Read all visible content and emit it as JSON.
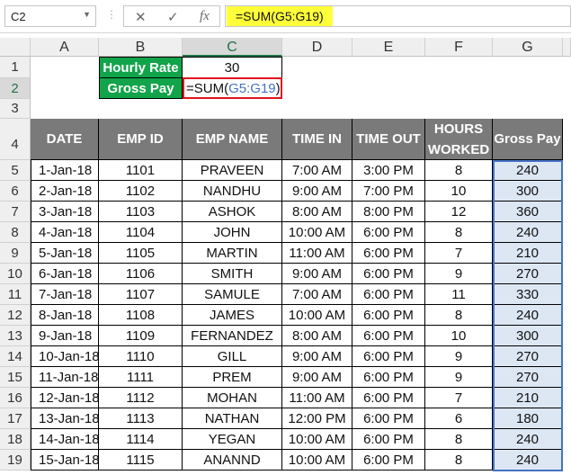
{
  "formula_bar": {
    "name_box": "C2",
    "formula": "=SUM(G5:G19)",
    "cancel_icon": "✕",
    "enter_icon": "✓",
    "fx_label": "fx"
  },
  "columns": [
    "A",
    "B",
    "C",
    "D",
    "E",
    "F",
    "G"
  ],
  "selected_column": "C",
  "row_numbers": [
    "1",
    "2",
    "3",
    "4",
    "5",
    "6",
    "7",
    "8",
    "9",
    "10",
    "11",
    "12",
    "13",
    "14",
    "15",
    "16",
    "17",
    "18",
    "19"
  ],
  "summary": {
    "hourly_rate_label": "Hourly Rate",
    "hourly_rate_value": "30",
    "gross_pay_label": "Gross Pay",
    "gross_pay_edit_prefix": "=SUM(",
    "gross_pay_edit_ref": "G5:G19",
    "gross_pay_edit_suffix": ")"
  },
  "table": {
    "headers": [
      "DATE",
      "EMP ID",
      "EMP NAME",
      "TIME IN",
      "TIME OUT",
      "HOURS WORKED",
      "Gross Pay"
    ],
    "rows": [
      [
        "1-Jan-18",
        "1101",
        "PRAVEEN",
        "7:00 AM",
        "3:00 PM",
        "8",
        "240"
      ],
      [
        "2-Jan-18",
        "1102",
        "NANDHU",
        "9:00 AM",
        "7:00 PM",
        "10",
        "300"
      ],
      [
        "3-Jan-18",
        "1103",
        "ASHOK",
        "8:00 AM",
        "8:00 PM",
        "12",
        "360"
      ],
      [
        "4-Jan-18",
        "1104",
        "JOHN",
        "10:00 AM",
        "6:00 PM",
        "8",
        "240"
      ],
      [
        "5-Jan-18",
        "1105",
        "MARTIN",
        "11:00 AM",
        "6:00 PM",
        "7",
        "210"
      ],
      [
        "6-Jan-18",
        "1106",
        "SMITH",
        "9:00 AM",
        "6:00 PM",
        "9",
        "270"
      ],
      [
        "7-Jan-18",
        "1107",
        "SAMULE",
        "7:00 AM",
        "6:00 PM",
        "11",
        "330"
      ],
      [
        "8-Jan-18",
        "1108",
        "JAMES",
        "10:00 AM",
        "6:00 PM",
        "8",
        "240"
      ],
      [
        "9-Jan-18",
        "1109",
        "FERNANDEZ",
        "8:00 AM",
        "6:00 PM",
        "10",
        "300"
      ],
      [
        "10-Jan-18",
        "1110",
        "GILL",
        "9:00 AM",
        "6:00 PM",
        "9",
        "270"
      ],
      [
        "11-Jan-18",
        "1111",
        "PREM",
        "9:00 AM",
        "6:00 PM",
        "9",
        "270"
      ],
      [
        "12-Jan-18",
        "1112",
        "MOHAN",
        "11:00 AM",
        "6:00 PM",
        "7",
        "210"
      ],
      [
        "13-Jan-18",
        "1113",
        "NATHAN",
        "12:00 PM",
        "6:00 PM",
        "6",
        "180"
      ],
      [
        "14-Jan-18",
        "1114",
        "YEGAN",
        "10:00 AM",
        "6:00 PM",
        "8",
        "240"
      ],
      [
        "15-Jan-18",
        "1115",
        "ANANND",
        "10:00 AM",
        "6:00 PM",
        "8",
        "240"
      ]
    ]
  }
}
